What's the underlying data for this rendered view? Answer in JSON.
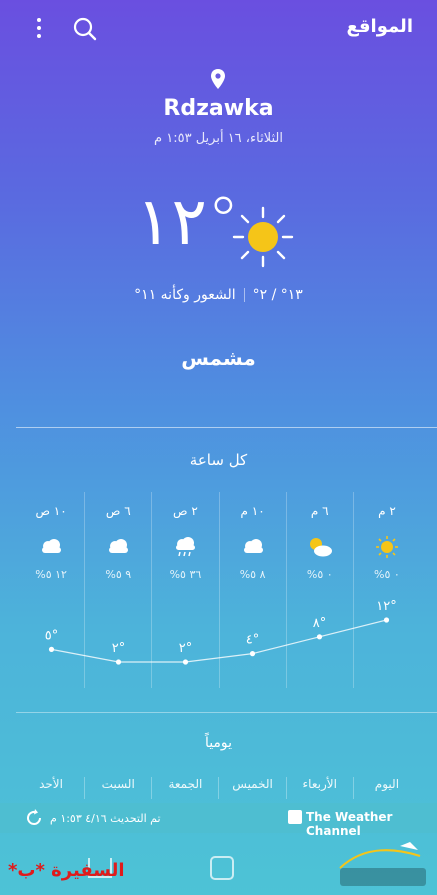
{
  "header": {
    "title": "المواقع",
    "menu_icon": "more-vertical-icon",
    "search_icon": "search-icon"
  },
  "location": {
    "city": "Rdzawka",
    "datetime": "الثلاثاء، ١٦ أبريل ١:٥٣ م",
    "pin_icon": "location-pin-icon"
  },
  "current": {
    "temperature": "١٢°",
    "icon": "sun-icon",
    "high_low": "١٣° / ٢°",
    "feels_like": "الشعور وكأنه ١١°",
    "condition": "مشمس"
  },
  "hourly": {
    "title": "كل ساعة",
    "items": [
      {
        "time": "٢ م",
        "icon": "sun-icon",
        "precip": "٠ ٥%",
        "temp": "١٢°",
        "value": 12
      },
      {
        "time": "٦ م",
        "icon": "partly-cloudy-icon",
        "precip": "٠ ٥%",
        "temp": "٨°",
        "value": 8
      },
      {
        "time": "١٠ م",
        "icon": "cloud-icon",
        "precip": "٨ ٥%",
        "temp": "٤°",
        "value": 4
      },
      {
        "time": "٢ ص",
        "icon": "rain-cloud-icon",
        "precip": "٣٦ ٥%",
        "temp": "٢°",
        "value": 2
      },
      {
        "time": "٦ ص",
        "icon": "cloud-icon",
        "precip": "٩ ٥%",
        "temp": "٢°",
        "value": 2
      },
      {
        "time": "١٠ ص",
        "icon": "cloud-icon",
        "precip": "١٢ ٥%",
        "temp": "٥°",
        "value": 5
      }
    ]
  },
  "daily": {
    "title": "يومياً",
    "days": [
      "اليوم",
      "الأربعاء",
      "الخميس",
      "الجمعة",
      "السبت",
      "الأحد"
    ]
  },
  "footer": {
    "updated": "تم التحديث ٤/١٦ ١:٥٣ م",
    "provider": "The Weather Channel",
    "refresh_icon": "refresh-icon"
  },
  "watermark": {
    "left_text": "السفيرة *ب*",
    "right_logo": "travelers-logo"
  },
  "colors": {
    "accent_sun": "#f5c518",
    "watermark": "#e01b1b"
  }
}
